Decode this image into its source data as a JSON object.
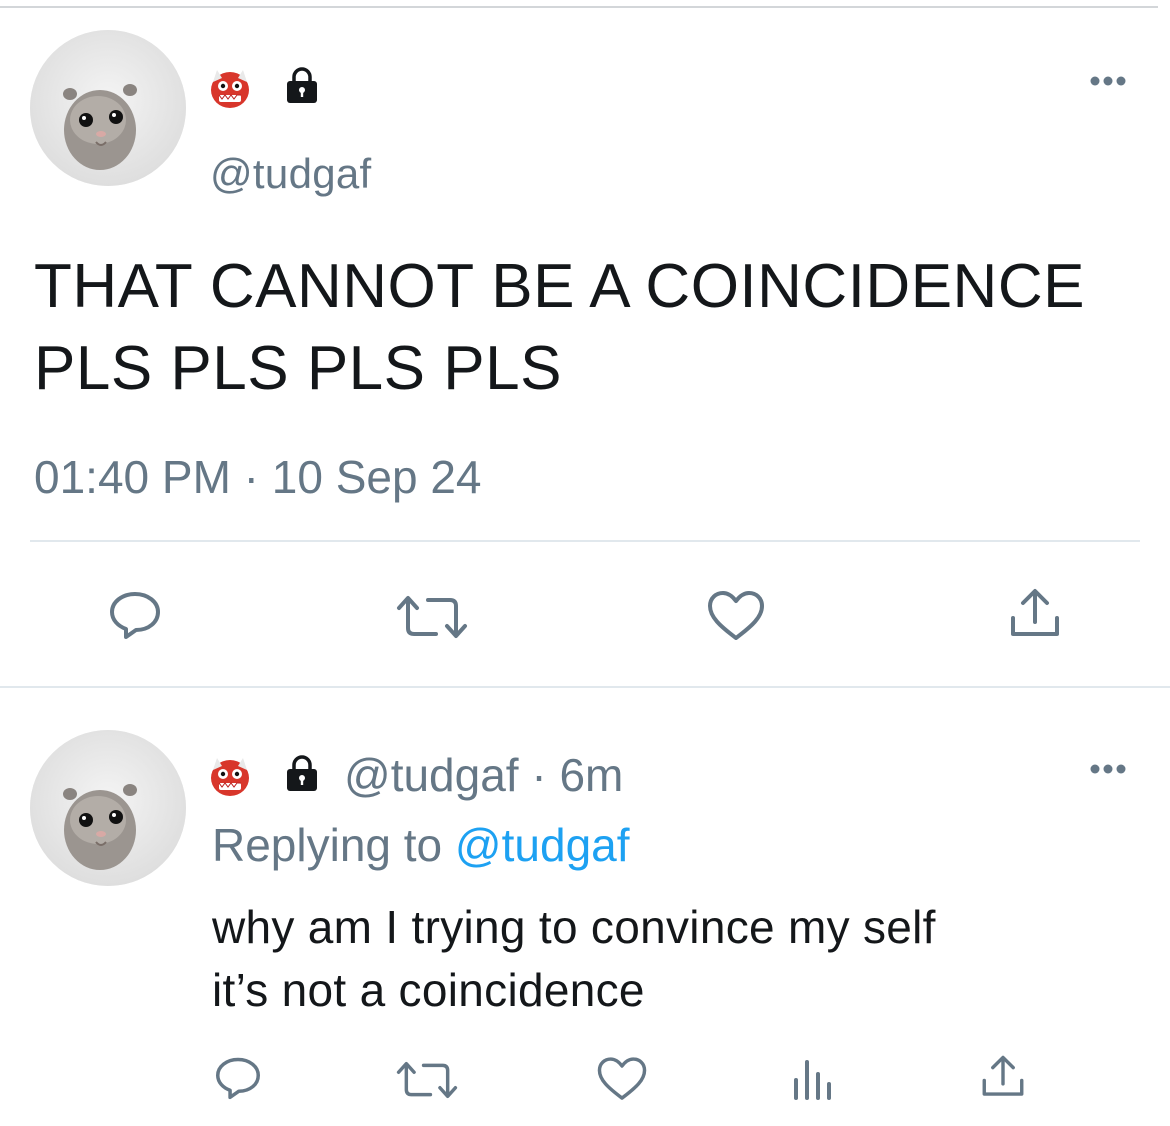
{
  "main_tweet": {
    "avatar": "hamster-avatar",
    "badges": [
      "ogre-emoji",
      "lock-icon"
    ],
    "handle": "@tudgaf",
    "text_line1": "THAT CANNOT BE A COINCIDENCE",
    "text_line2": "PLS PLS PLS PLS",
    "timestamp": "01:40 PM · 10 Sep 24",
    "actions": [
      "reply-icon",
      "retweet-icon",
      "like-icon",
      "share-icon"
    ]
  },
  "reply_tweet": {
    "avatar": "hamster-avatar",
    "badges": [
      "ogre-emoji",
      "lock-icon"
    ],
    "handle_time": "@tudgaf · 6m",
    "replying_prefix": "Replying to ",
    "replying_mention": "@tudgaf",
    "text_line1": "why am I trying to convince my self",
    "text_line2": "it’s not a coincidence",
    "actions": [
      "reply-icon",
      "retweet-icon",
      "like-icon",
      "analytics-icon",
      "share-icon"
    ]
  },
  "colors": {
    "text": "#14171a",
    "secondary": "#657786",
    "link": "#1da1f2",
    "divider": "#e1e8ed"
  }
}
